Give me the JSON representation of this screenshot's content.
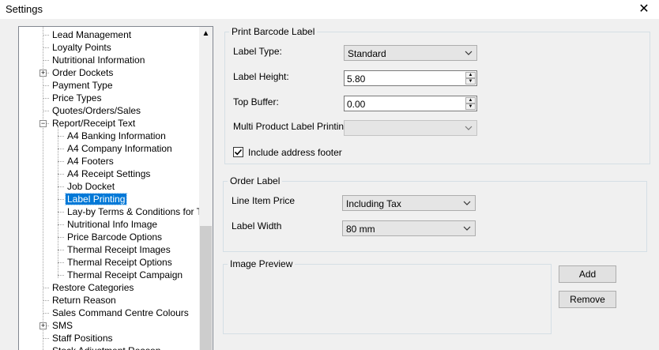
{
  "window": {
    "title": "Settings",
    "close_glyph": "✕"
  },
  "tree": {
    "items": [
      {
        "label": "Lead Management",
        "level": 1,
        "expander": ""
      },
      {
        "label": "Loyalty Points",
        "level": 1,
        "expander": ""
      },
      {
        "label": "Nutritional Information",
        "level": 1,
        "expander": ""
      },
      {
        "label": "Order Dockets",
        "level": 1,
        "expander": "+"
      },
      {
        "label": "Payment Type",
        "level": 1,
        "expander": ""
      },
      {
        "label": "Price Types",
        "level": 1,
        "expander": ""
      },
      {
        "label": "Quotes/Orders/Sales",
        "level": 1,
        "expander": ""
      },
      {
        "label": "Report/Receipt Text",
        "level": 1,
        "expander": "−"
      },
      {
        "label": "A4 Banking Information",
        "level": 2,
        "expander": ""
      },
      {
        "label": "A4 Company Information",
        "level": 2,
        "expander": ""
      },
      {
        "label": "A4 Footers",
        "level": 2,
        "expander": ""
      },
      {
        "label": "A4 Receipt Settings",
        "level": 2,
        "expander": ""
      },
      {
        "label": "Job Docket",
        "level": 2,
        "expander": ""
      },
      {
        "label": "Label Printing",
        "level": 2,
        "expander": "",
        "selected": true
      },
      {
        "label": "Lay-by Terms & Conditions for Thermal",
        "level": 2,
        "expander": ""
      },
      {
        "label": "Nutritional Info Image",
        "level": 2,
        "expander": ""
      },
      {
        "label": "Price Barcode Options",
        "level": 2,
        "expander": ""
      },
      {
        "label": "Thermal Receipt Images",
        "level": 2,
        "expander": ""
      },
      {
        "label": "Thermal Receipt Options",
        "level": 2,
        "expander": ""
      },
      {
        "label": "Thermal Receipt Campaign",
        "level": 2,
        "expander": ""
      },
      {
        "label": "Restore Categories",
        "level": 1,
        "expander": ""
      },
      {
        "label": "Return Reason",
        "level": 1,
        "expander": ""
      },
      {
        "label": "Sales Command Centre Colours",
        "level": 1,
        "expander": ""
      },
      {
        "label": "SMS",
        "level": 1,
        "expander": "+"
      },
      {
        "label": "Staff Positions",
        "level": 1,
        "expander": ""
      },
      {
        "label": "Stock Adjustment Reason",
        "level": 1,
        "expander": ""
      }
    ],
    "scroll_up_glyph": "▲"
  },
  "print_barcode": {
    "title": "Print Barcode Label",
    "label_type": {
      "label": "Label Type:",
      "value": "Standard"
    },
    "label_height": {
      "label": "Label Height:",
      "value": "5.80"
    },
    "top_buffer": {
      "label": "Top Buffer:",
      "value": "0.00"
    },
    "multi_product": {
      "label": "Multi Product Label Printing",
      "value": ""
    },
    "include_footer": {
      "label": "Include address footer",
      "checked": true
    }
  },
  "order_label": {
    "title": "Order Label",
    "line_item_price": {
      "label": "Line Item Price",
      "value": "Including Tax"
    },
    "label_width": {
      "label": "Label Width",
      "value": "80 mm"
    }
  },
  "image_preview": {
    "title": "Image Preview",
    "add_label": "Add",
    "remove_label": "Remove"
  }
}
